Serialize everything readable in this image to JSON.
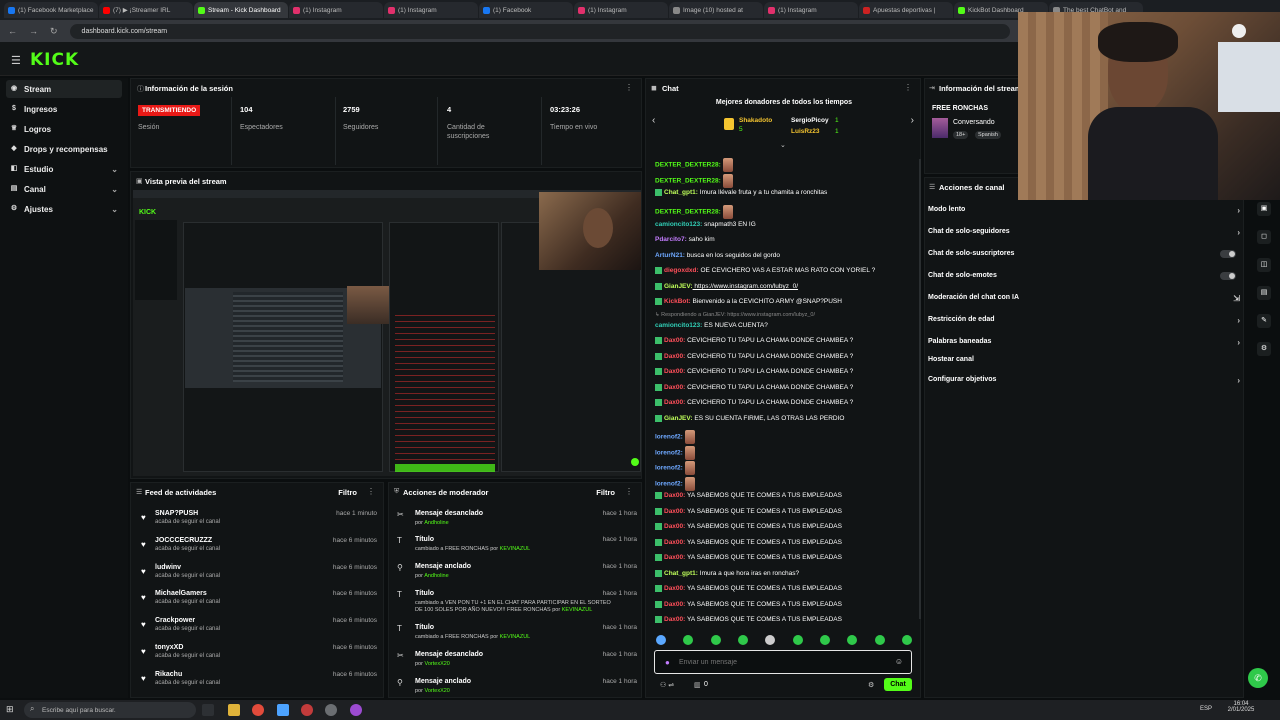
{
  "browser": {
    "tabs": [
      {
        "label": "(1) Facebook Marketplace",
        "color": "#1877f2"
      },
      {
        "label": "(7) ▶ ¡Streamer IRL",
        "color": "#ff0000"
      },
      {
        "label": "Stream - Kick Dashboard",
        "color": "#53fc18",
        "active": true
      },
      {
        "label": "(1) Instagram",
        "color": "#e1306c"
      },
      {
        "label": "(1) Instagram",
        "color": "#e1306c"
      },
      {
        "label": "(1) Facebook",
        "color": "#1877f2"
      },
      {
        "label": "(1) Instagram",
        "color": "#e1306c"
      },
      {
        "label": "Image (10) hosted at",
        "color": "#888888"
      },
      {
        "label": "(1) Instagram",
        "color": "#e1306c"
      },
      {
        "label": "Apuestas deportivas |",
        "color": "#cc2222"
      },
      {
        "label": "KickBot Dashboard",
        "color": "#53fc18"
      },
      {
        "label": "The best ChatBot and",
        "color": "#888888"
      }
    ],
    "url": "dashboard.kick.com/stream"
  },
  "brand": {
    "logo": "KICK",
    "accent": "#53fc18"
  },
  "sidebar": {
    "items": [
      {
        "label": "Stream",
        "icon": "broadcast-icon",
        "active": true
      },
      {
        "label": "Ingresos",
        "icon": "money-icon"
      },
      {
        "label": "Logros",
        "icon": "trophy-icon"
      },
      {
        "label": "Drops y recompensas",
        "icon": "gift-icon"
      },
      {
        "label": "Estudio",
        "icon": "studio-icon",
        "chevron": true
      },
      {
        "label": "Canal",
        "icon": "channel-icon",
        "chevron": true
      },
      {
        "label": "Ajustes",
        "icon": "settings-icon",
        "chevron": true
      }
    ]
  },
  "session": {
    "title": "Información de la sesión",
    "live_badge": "TRANSMITIENDO",
    "live_label": "Sesión",
    "stats": [
      {
        "value": "104",
        "label": "Espectadores"
      },
      {
        "value": "2759",
        "label": "Seguidores"
      },
      {
        "value": "4",
        "label": "Cantidad de suscripciones"
      },
      {
        "value": "03:23:26",
        "label": "Tiempo en vivo"
      }
    ]
  },
  "preview": {
    "title": "Vista previa del stream"
  },
  "feed": {
    "title": "Feed de actividades",
    "filter": "Filtro",
    "items": [
      {
        "name": "SNAP?PUSH",
        "sub": "acaba de seguir el canal",
        "time": "hace 1 minuto"
      },
      {
        "name": "JOCCCECRUZZZ",
        "sub": "acaba de seguir el canal",
        "time": "hace 6 minutos"
      },
      {
        "name": "ludwinv",
        "sub": "acaba de seguir el canal",
        "time": "hace 6 minutos"
      },
      {
        "name": "MichaelGamers",
        "sub": "acaba de seguir el canal",
        "time": "hace 6 minutos"
      },
      {
        "name": "Crackpower",
        "sub": "acaba de seguir el canal",
        "time": "hace 6 minutos"
      },
      {
        "name": "tonyxXD",
        "sub": "acaba de seguir el canal",
        "time": "hace 6 minutos"
      },
      {
        "name": "Rikachu",
        "sub": "acaba de seguir el canal",
        "time": "hace 6 minutos"
      }
    ]
  },
  "mod": {
    "title": "Acciones de moderador",
    "filter": "Filtro",
    "items": [
      {
        "title": "Mensaje desanclado",
        "sub_pre": "por ",
        "sub_user": "Andholine",
        "time": "hace 1 hora",
        "icon": "unpin-icon"
      },
      {
        "title": "Título",
        "sub_pre": "cambiado a FREE RONCHAS por ",
        "sub_user": "KEVINAZUL",
        "time": "hace 1 hora",
        "icon": "text-icon"
      },
      {
        "title": "Mensaje anclado",
        "sub_pre": "por ",
        "sub_user": "Andholine",
        "time": "hace 1 hora",
        "icon": "pin-icon"
      },
      {
        "title": "Título",
        "sub_pre": "cambiado a VEN PON TU +1 EN EL CHAT PARA PARTICIPAR EN EL SORTEO",
        "sub_pre2": "DE 100 SOLES POR AÑO NUEVO!!! FREE RONCHAS por ",
        "sub_user": "KEVINAZUL",
        "time": "hace 1 hora",
        "icon": "text-icon"
      },
      {
        "title": "Título",
        "sub_pre": "cambiado a FREE RONCHAS por ",
        "sub_user": "KEVINAZUL",
        "time": "hace 1 hora",
        "icon": "text-icon"
      },
      {
        "title": "Mensaje desanclado",
        "sub_pre": "por ",
        "sub_user": "VortexX20",
        "time": "hace 1 hora",
        "icon": "unpin-icon"
      },
      {
        "title": "Mensaje anclado",
        "sub_pre": "por ",
        "sub_user": "VortexX20",
        "time": "hace 1 hora",
        "icon": "pin-icon"
      }
    ]
  },
  "chat": {
    "title": "Chat",
    "donors_title": "Mejores donadores de todos los tiempos",
    "donors": [
      {
        "name": "Shakadoto",
        "amount": "5"
      },
      {
        "name": "SergioPicoy",
        "amount": "1"
      },
      {
        "name": "LuisRz23",
        "amount": "1"
      }
    ],
    "messages": [
      {
        "user": "DEXTER_DEXTER28:",
        "text": "",
        "cls": "u-green",
        "emote": true
      },
      {
        "user": "DEXTER_DEXTER28:",
        "text": "",
        "cls": "u-green",
        "emote": true
      },
      {
        "user": "Chat_gpt1:",
        "text": " Imura llévale fruta y a tu chamita a ronchitas",
        "cls": "u-lime"
      },
      {
        "user": "DEXTER_DEXTER28:",
        "text": "",
        "cls": "u-green",
        "emote": true
      },
      {
        "user": "camioncito123:",
        "text": " snapmath3 EN IG",
        "cls": "u-teal"
      },
      {
        "user": "Pdarcito7:",
        "text": " saho kim",
        "cls": "u-purple"
      },
      {
        "user": "ArturN21:",
        "text": " busca en los seguidos del gordo",
        "cls": "u-blue"
      },
      {
        "user": "diegoxdxd:",
        "text": " OE CEVICHERO VAS A ESTAR MAS RATO CON YORIEL ?",
        "cls": "u-red"
      },
      {
        "user": "GianJEV:",
        "text": " https://www.instagram.com/lubyz_0/",
        "cls": "u-lime",
        "link": true
      },
      {
        "user": "KickBot:",
        "text": " Bienvenido a la CEVICHITO ARMY @SNAP?PUSH",
        "cls": "u-red"
      },
      {
        "user": "↳ Respondiendo a GianJEV:",
        "text": " https://www.instagram.com/lubyz_0/",
        "cls": "u-reply"
      },
      {
        "user": "camioncito123:",
        "text": " ES NUEVA CUENTA?",
        "cls": "u-teal"
      },
      {
        "user": "Dax00:",
        "text": " CEVICHERO TU TAPU LA CHAMA DONDE CHAMBEA ?",
        "cls": "u-red"
      },
      {
        "user": "Dax00:",
        "text": " CEVICHERO TU TAPU LA CHAMA DONDE CHAMBEA ?",
        "cls": "u-red"
      },
      {
        "user": "Dax00:",
        "text": " CEVICHERO TU TAPU LA CHAMA DONDE CHAMBEA ?",
        "cls": "u-red"
      },
      {
        "user": "Dax00:",
        "text": " CEVICHERO TU TAPU LA CHAMA DONDE CHAMBEA ?",
        "cls": "u-red"
      },
      {
        "user": "Dax00:",
        "text": " CEVICHERO TU TAPU LA CHAMA DONDE CHAMBEA ?",
        "cls": "u-red"
      },
      {
        "user": "GianJEV:",
        "text": " ES SU CUENTA FIRME, LAS OTRAS LAS PERDIO",
        "cls": "u-lime"
      },
      {
        "user": "lorenof2:",
        "text": "",
        "cls": "u-blue",
        "emote": true
      },
      {
        "user": "lorenof2:",
        "text": "",
        "cls": "u-blue",
        "emote": true
      },
      {
        "user": "lorenof2:",
        "text": "",
        "cls": "u-blue",
        "emote": true
      },
      {
        "user": "lorenof2:",
        "text": "",
        "cls": "u-blue",
        "emote": true
      },
      {
        "user": "Dax00:",
        "text": " YA SABEMOS QUE TE COMES A TUS EMPLEADAS",
        "cls": "u-red"
      },
      {
        "user": "Dax00:",
        "text": " YA SABEMOS QUE TE COMES A TUS EMPLEADAS",
        "cls": "u-red"
      },
      {
        "user": "Dax00:",
        "text": " YA SABEMOS QUE TE COMES A TUS EMPLEADAS",
        "cls": "u-red"
      },
      {
        "user": "Dax00:",
        "text": " YA SABEMOS QUE TE COMES A TUS EMPLEADAS",
        "cls": "u-red"
      },
      {
        "user": "Dax00:",
        "text": " YA SABEMOS QUE TE COMES A TUS EMPLEADAS",
        "cls": "u-red"
      },
      {
        "user": "Chat_gpt1:",
        "text": " Imura a que hora iras en ronchas?",
        "cls": "u-lime"
      },
      {
        "user": "Dax00:",
        "text": " YA SABEMOS QUE TE COMES A TUS EMPLEADAS",
        "cls": "u-red"
      },
      {
        "user": "Dax00:",
        "text": " YA SABEMOS QUE TE COMES A TUS EMPLEADAS",
        "cls": "u-red"
      },
      {
        "user": "Dax00:",
        "text": " YA SABEMOS QUE TE COMES A TUS EMPLEADAS",
        "cls": "u-red"
      }
    ],
    "input_placeholder": "Enviar un mensaje",
    "send_label": "Chat",
    "viewers_count": "0"
  },
  "info": {
    "title": "Información del stream",
    "stream_title": "FREE RONCHAS",
    "category": "Conversando",
    "tags": [
      "18+",
      "Spanish"
    ]
  },
  "actions": {
    "title": "Acciones de canal",
    "items": [
      {
        "label": "Modo lento",
        "kind": "chevron"
      },
      {
        "label": "Chat de solo-seguidores",
        "kind": "chevron"
      },
      {
        "label": "Chat de solo-suscriptores",
        "kind": "toggle"
      },
      {
        "label": "Chat de solo-emotes",
        "kind": "toggle"
      },
      {
        "label": "Moderación del chat con IA",
        "kind": "icon"
      },
      {
        "label": "Restricción de edad",
        "kind": "chevron"
      },
      {
        "label": "Palabras baneadas",
        "kind": "chevron"
      },
      {
        "label": "Hostear canal",
        "kind": "none"
      },
      {
        "label": "Configurar objetivos",
        "kind": "chevron"
      }
    ]
  },
  "taskbar": {
    "search_placeholder": "Escribe aquí para buscar.",
    "time": "16:04",
    "date": "2/01/2025",
    "lang": "ESP"
  }
}
